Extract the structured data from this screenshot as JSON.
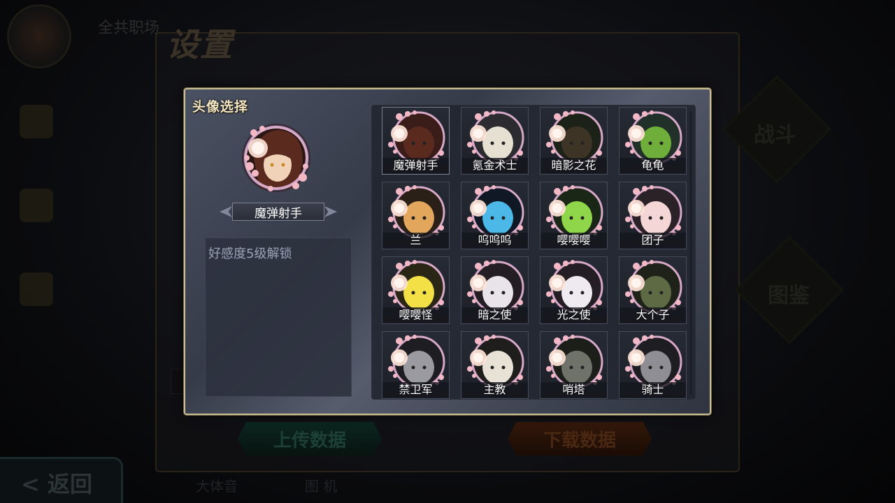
{
  "background": {
    "settings_title": "设置",
    "top_text": "全共职场",
    "upload_button": "上传数据",
    "download_button": "下载数据",
    "back_button": "< 返回",
    "right_labels": [
      "战斗",
      "图鉴"
    ],
    "bottom_texts": [
      "大体音",
      "图 机"
    ]
  },
  "modal": {
    "title": "头像选择",
    "selected": {
      "name": "魔弹射手",
      "unlock_text": "好感度5级解锁",
      "ring_color": "#c46a4e",
      "hair_color": "#5a2a1e"
    },
    "avatars": [
      {
        "name": "魔弹射手",
        "icon": "demon-gunner-portrait",
        "bg": "#3a1c18",
        "face": "#5a2a1e"
      },
      {
        "name": "氪金术士",
        "icon": "krypton-mage-portrait",
        "bg": "#2b2b30",
        "face": "#e6e0d2"
      },
      {
        "name": "暗影之花",
        "icon": "shadow-flower-portrait",
        "bg": "#1c2218",
        "face": "#3d3426"
      },
      {
        "name": "龟龟",
        "icon": "turtle-portrait",
        "bg": "#22302a",
        "face": "#6fae3a"
      },
      {
        "name": "兰",
        "icon": "lan-portrait",
        "bg": "#2a2018",
        "face": "#e2a65c"
      },
      {
        "name": "呜呜呜",
        "icon": "blue-slime-portrait",
        "bg": "#101826",
        "face": "#4cb8e8"
      },
      {
        "name": "嘤嘤嘤",
        "icon": "green-slime-portrait",
        "bg": "#1a2616",
        "face": "#8fd64a"
      },
      {
        "name": "团子",
        "icon": "pink-dango-portrait",
        "bg": "#2a2226",
        "face": "#f4d6d6"
      },
      {
        "name": "嘤嘤怪",
        "icon": "yellow-slime-portrait",
        "bg": "#2a2616",
        "face": "#f2e046"
      },
      {
        "name": "暗之使",
        "icon": "dark-envoy-portrait",
        "bg": "#241e24",
        "face": "#e8e4ea"
      },
      {
        "name": "光之使",
        "icon": "light-envoy-portrait",
        "bg": "#241e24",
        "face": "#eeeaf0"
      },
      {
        "name": "大个子",
        "icon": "big-guy-portrait",
        "bg": "#1e2218",
        "face": "#5e6a44"
      },
      {
        "name": "禁卫军",
        "icon": "royal-guard-portrait",
        "bg": "#1e1e22",
        "face": "#9a9aa0"
      },
      {
        "name": "主教",
        "icon": "bishop-portrait",
        "bg": "#201e1c",
        "face": "#e8e2d6"
      },
      {
        "name": "哨塔",
        "icon": "watchtower-portrait",
        "bg": "#1c1e1a",
        "face": "#6e7268"
      },
      {
        "name": "骑士",
        "icon": "knight-portrait",
        "bg": "#1e1e22",
        "face": "#8e8e94"
      }
    ],
    "colors": {
      "frame_gold": "#cbbf93",
      "ring": "#d7a9c8",
      "sakura": "#f2b8c6"
    }
  }
}
